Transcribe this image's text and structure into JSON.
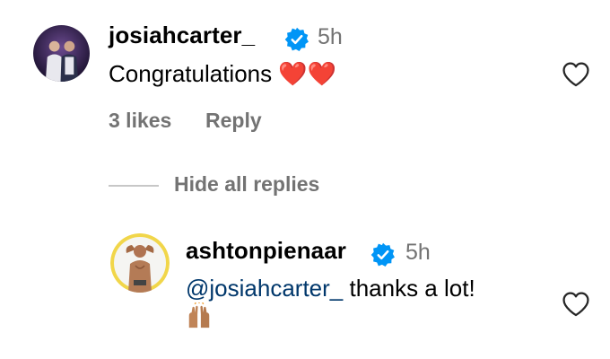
{
  "comments": [
    {
      "username": "josiahcarter_",
      "time": "5h",
      "text": "Congratulations ❤️❤️",
      "likes": "3 likes",
      "reply": "Reply"
    }
  ],
  "replies_toggle": "Hide all replies",
  "reply_comment": {
    "username": "ashtonpienaar",
    "time": "5h",
    "mention": "@josiahcarter_",
    "text": "thanks a lot!"
  },
  "colors": {
    "verified": "#0095f6",
    "meta_gray": "#737373",
    "mention": "#00376b",
    "heart_red": "#ff3040"
  },
  "icons": [
    "verified-badge-icon",
    "heart-outline-icon",
    "raised-hands-icon"
  ]
}
